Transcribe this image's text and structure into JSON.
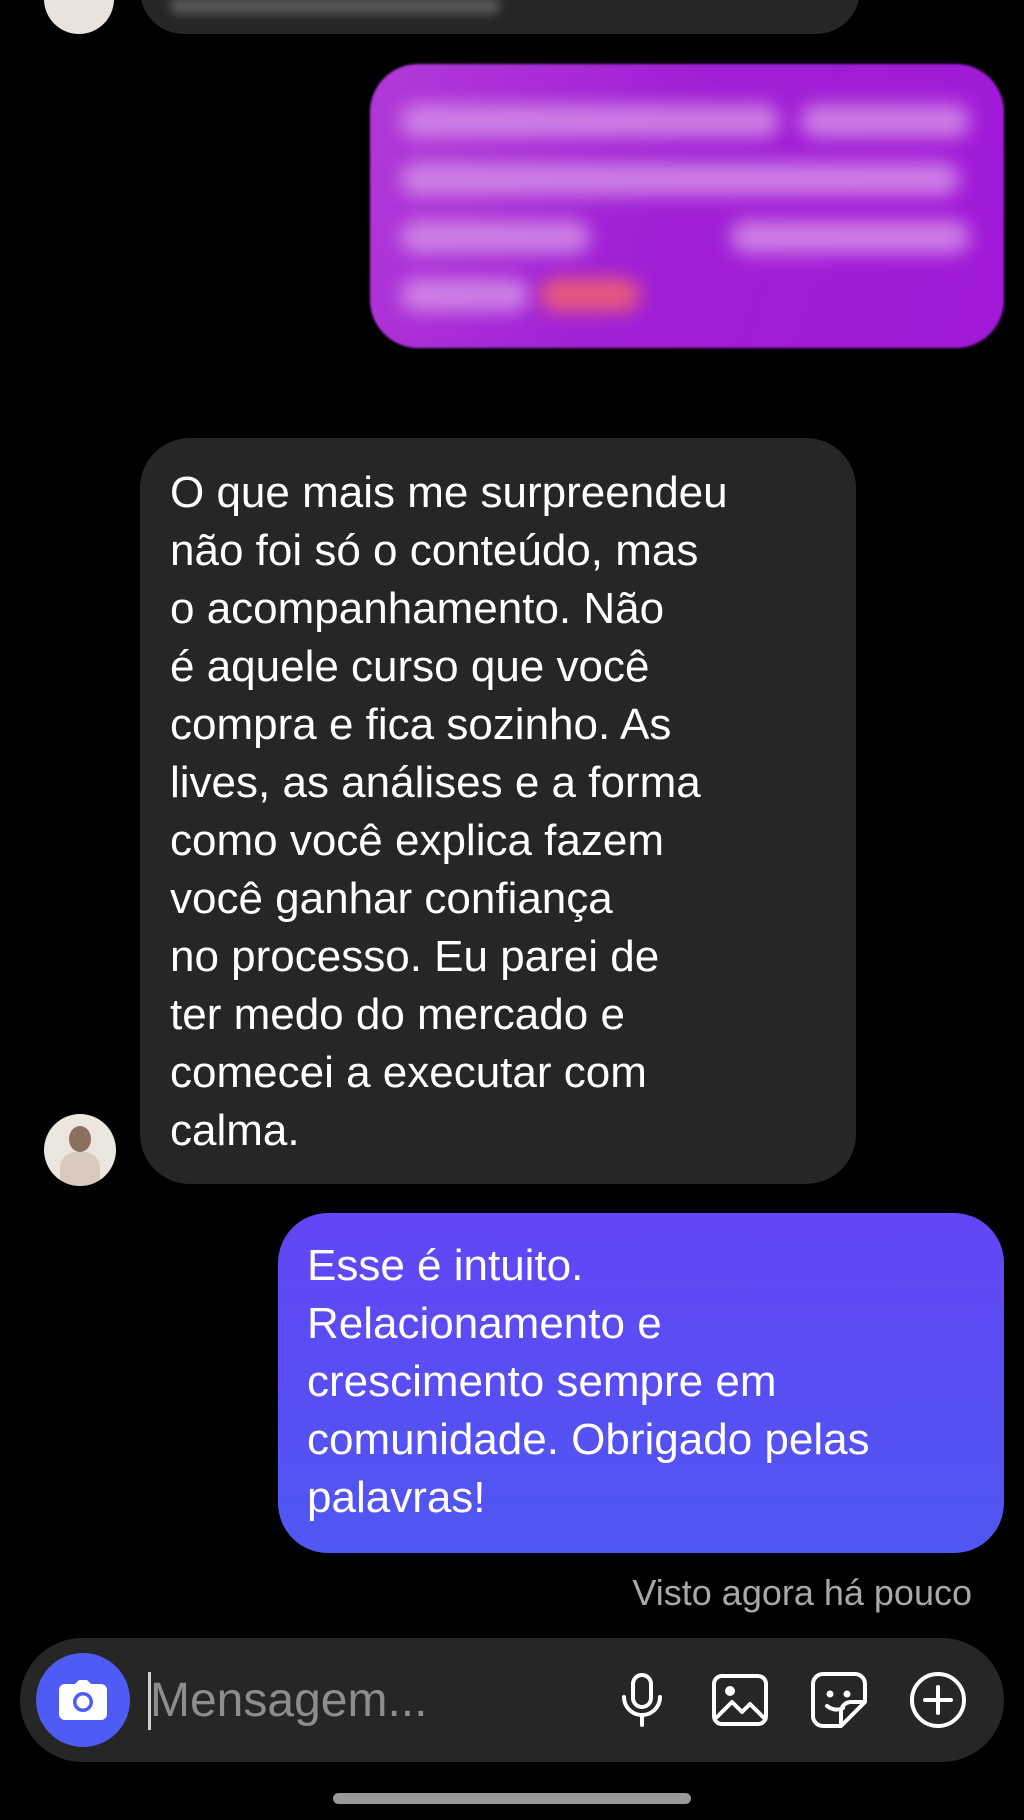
{
  "colors": {
    "background": "#000000",
    "received_bubble": "#262626",
    "sent_bubble": "#5a4ff4",
    "camera_button": "#4f5bf5",
    "seen_text": "#a8a8a8"
  },
  "messages": {
    "received": {
      "text": "O que mais me surpreendeu\nnão foi só o conteúdo, mas\no acompanhamento. Não\né aquele curso que você\ncompra e fica sozinho. As\nlives, as análises e a forma\ncomo você explica fazem\nvocê ganhar confiança\nno processo. Eu parei de\nter medo do mercado e\ncomecei a executar com\ncalma."
    },
    "sent": {
      "text": "Esse é intuito.\nRelacionamento e\ncrescimento sempre em\ncomunidade. Obrigado pelas\npalavras!"
    },
    "seen_status": "Visto agora há pouco"
  },
  "composer": {
    "placeholder": "Mensagem...",
    "icons": [
      "camera-icon",
      "microphone-icon",
      "gallery-icon",
      "sticker-icon",
      "plus-circle-icon"
    ]
  }
}
